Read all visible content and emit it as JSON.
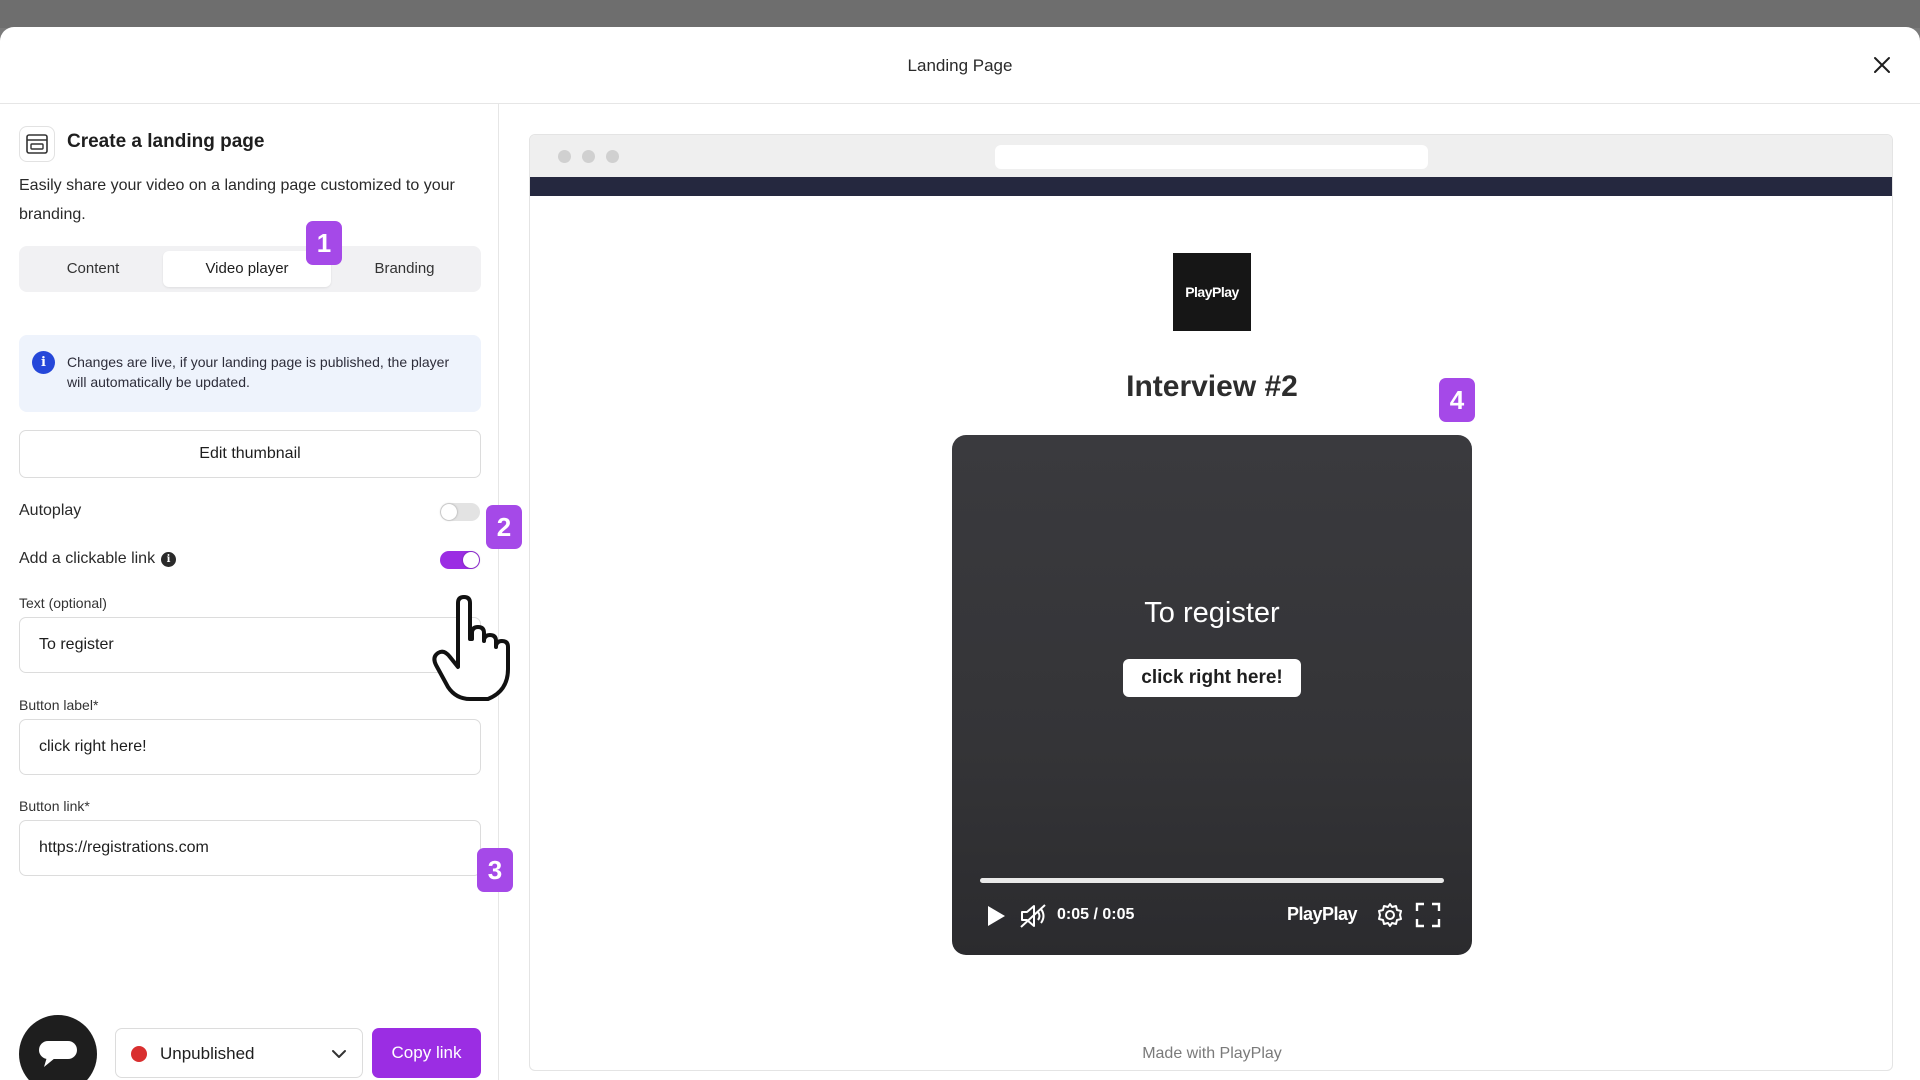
{
  "modal": {
    "title": "Landing Page"
  },
  "sidebar": {
    "title": "Create a landing page",
    "description": "Easily share your video on a landing page customized to your branding.",
    "tabs": [
      {
        "label": "Content",
        "active": false
      },
      {
        "label": "Video player",
        "active": true
      },
      {
        "label": "Branding",
        "active": false
      }
    ],
    "info": "Changes are live, if your landing page is published, the player will automatically be updated.",
    "edit_thumbnail_label": "Edit thumbnail",
    "autoplay": {
      "label": "Autoplay",
      "enabled": false
    },
    "clickable_link": {
      "label": "Add a clickable link",
      "enabled": true
    },
    "text_field": {
      "label": "Text (optional)",
      "value": "To register"
    },
    "button_label_field": {
      "label": "Button label*",
      "value": "click right here!"
    },
    "button_link_field": {
      "label": "Button link*",
      "value": "https://registrations.com"
    },
    "status": {
      "label": "Unpublished",
      "color": "#d92f2f"
    },
    "copy_link_label": "Copy link"
  },
  "badges": [
    "1",
    "2",
    "3",
    "4"
  ],
  "preview": {
    "logo_text": "PlayPlay",
    "title": "Interview #2",
    "video": {
      "overlay_text": "To register",
      "cta_label": "click right here!",
      "time": "0:05 / 0:05",
      "progress": 1.0,
      "brand": "PlayPlay"
    },
    "footer": "Made with PlayPlay"
  },
  "colors": {
    "accent": "#9b2de3",
    "badge": "#a549e8",
    "info_bg": "#eef3fc",
    "info_icon": "#2547d9",
    "nav_strip": "#25283f"
  }
}
